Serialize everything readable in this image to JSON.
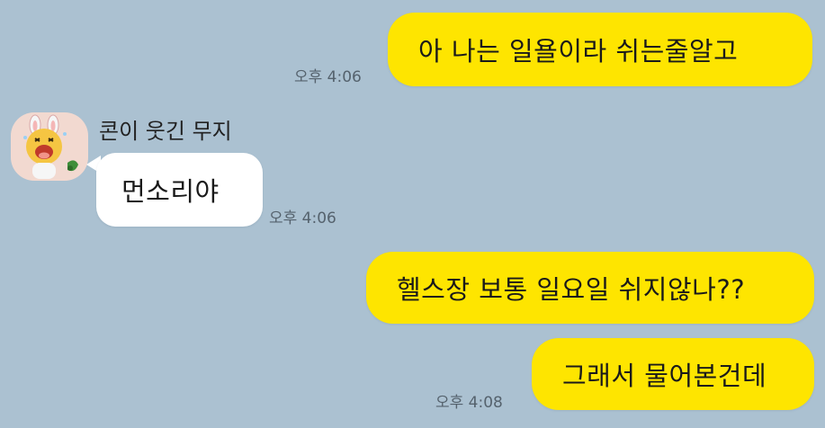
{
  "chat": {
    "messages": [
      {
        "sender": "me",
        "text": "아 나는 일욜이라 쉬는줄알고",
        "time": "오후 4:06"
      },
      {
        "sender": "other",
        "name": "콘이 웃긴 무지",
        "text": "먼소리야",
        "time": "오후 4:06"
      },
      {
        "sender": "me",
        "text": "헬스장 보통 일요일 쉬지않나??"
      },
      {
        "sender": "me",
        "text": "그래서 물어본건데",
        "time": "오후 4:08"
      }
    ]
  },
  "colors": {
    "background": "#abc1d1",
    "my_bubble": "#fee500",
    "other_bubble": "#ffffff"
  },
  "icons": {
    "avatar": "muzi-con-character-icon"
  }
}
